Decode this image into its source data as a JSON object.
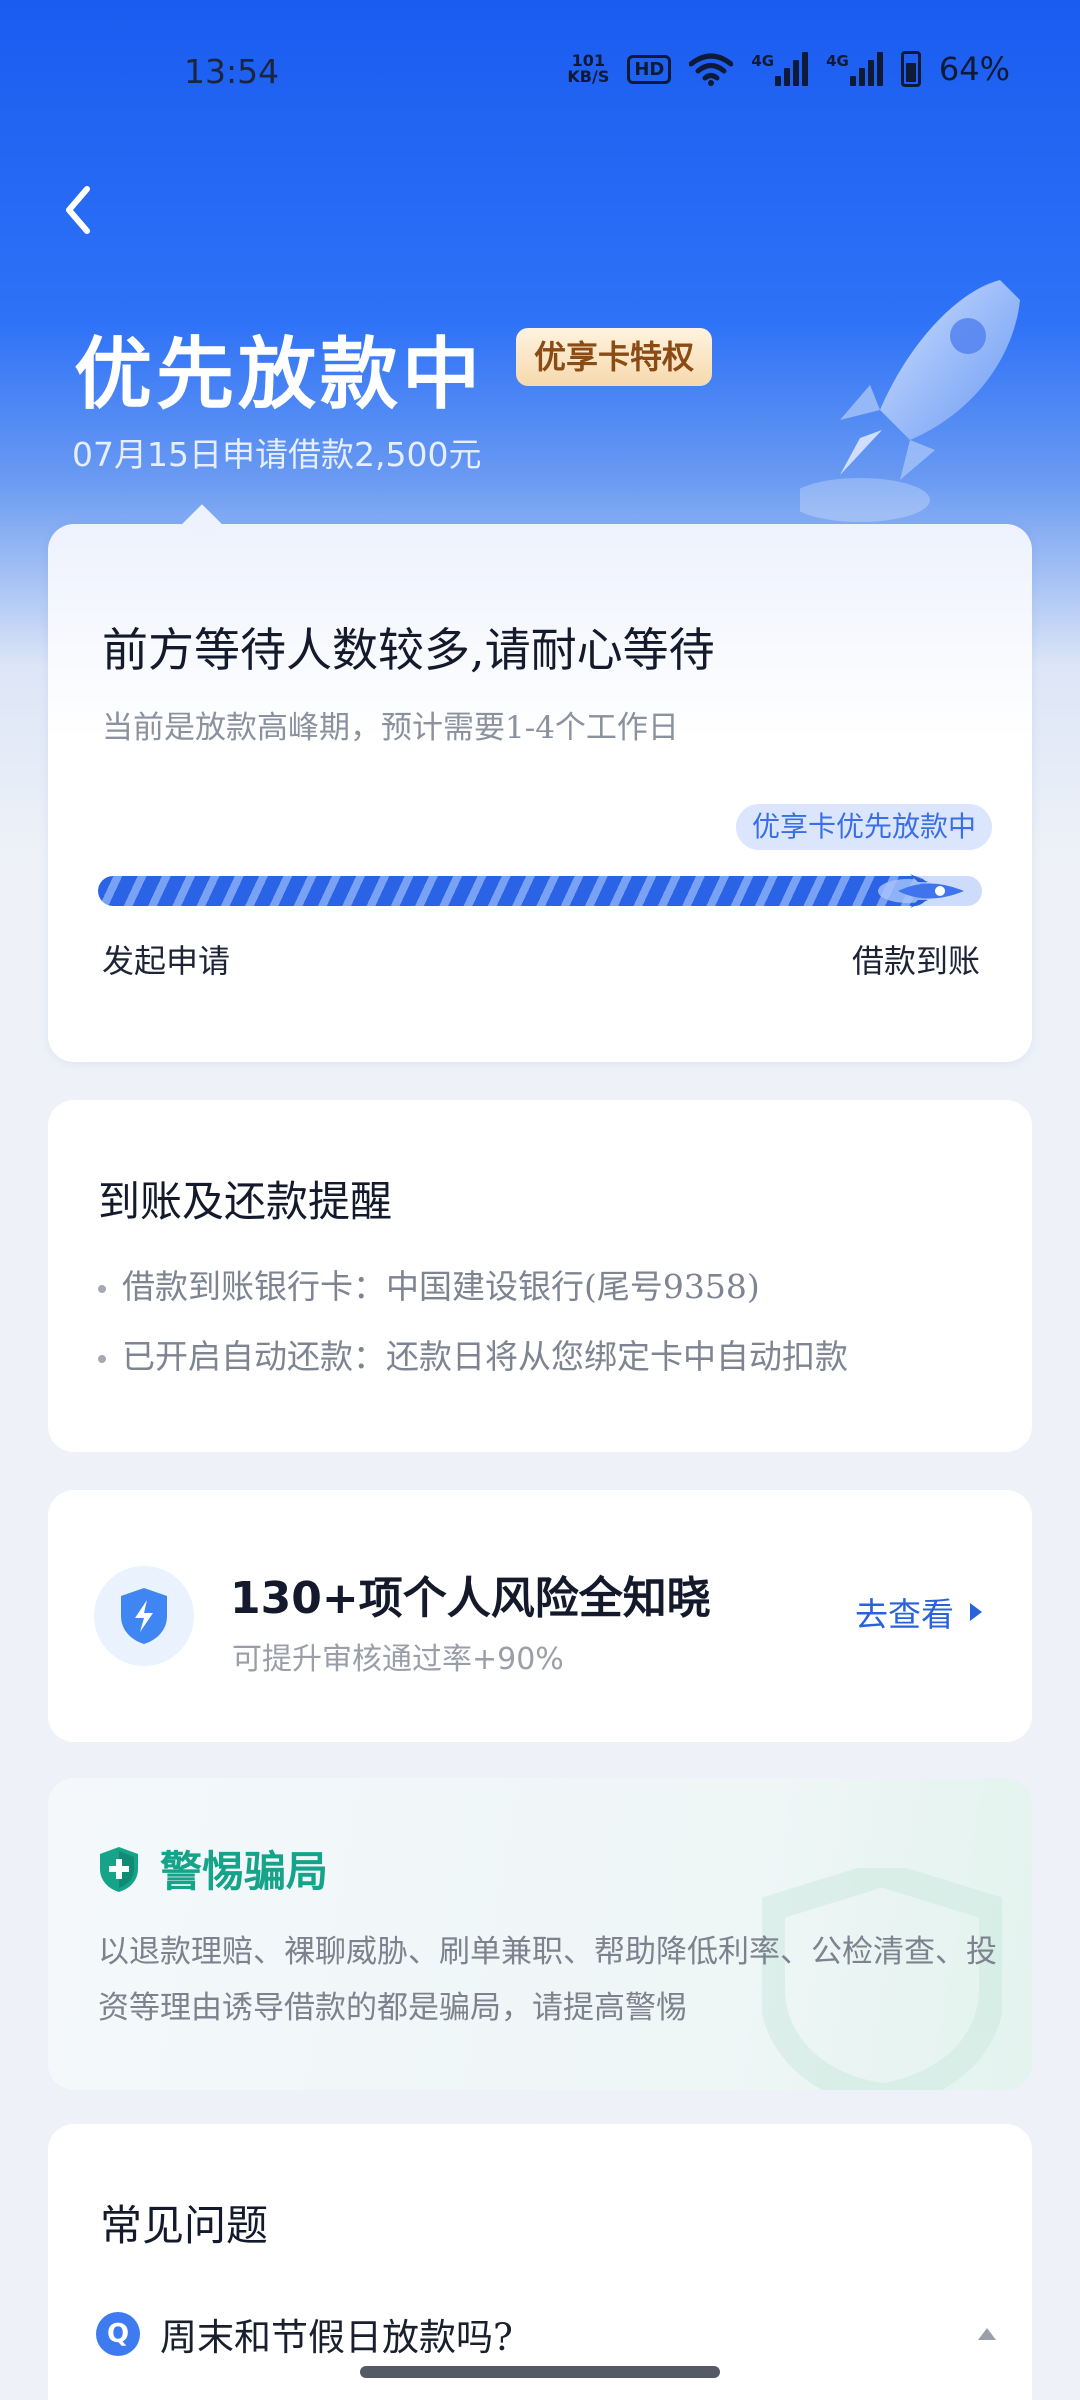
{
  "status_bar": {
    "time": "13:54",
    "net_speed_top": "101",
    "net_speed_bottom": "KB/S",
    "hd": "HD",
    "sim1": "4G",
    "sim2": "4G",
    "battery": "64%"
  },
  "hero": {
    "title": "优先放款中",
    "badge": "优享卡特权",
    "subtitle": "07月15日申请借款2,500元"
  },
  "progress": {
    "title": "前方等待人数较多,请耐心等待",
    "subtitle": "当前是放款高峰期，预计需要1-4个工作日",
    "tag": "优享卡优先放款中",
    "start_label": "发起申请",
    "end_label": "借款到账",
    "fraction": 0.94
  },
  "reminder": {
    "title": "到账及还款提醒",
    "items": [
      "借款到账银行卡：中国建设银行(尾号9358)",
      "已开启自动还款：还款日将从您绑定卡中自动扣款"
    ]
  },
  "risk": {
    "icon": "shield-bolt-icon",
    "title": "130+项个人风险全知晓",
    "subtitle": "可提升审核通过率+90%",
    "link": "去查看"
  },
  "fraud": {
    "icon": "shield-check-icon",
    "title": "警惕骗局",
    "body": "以退款理赔、裸聊威胁、刷单兼职、帮助降低利率、公检清查、投资等理由诱导借款的都是骗局，请提高警惕"
  },
  "faq": {
    "title": "常见问题",
    "q_badge": "Q",
    "first_question": "周末和节假日放款吗?"
  },
  "colors": {
    "primary": "#2a62dd",
    "hero_top": "#1a5cf0",
    "fraud_green": "#15a38a",
    "badge_text": "#8a4b14"
  }
}
